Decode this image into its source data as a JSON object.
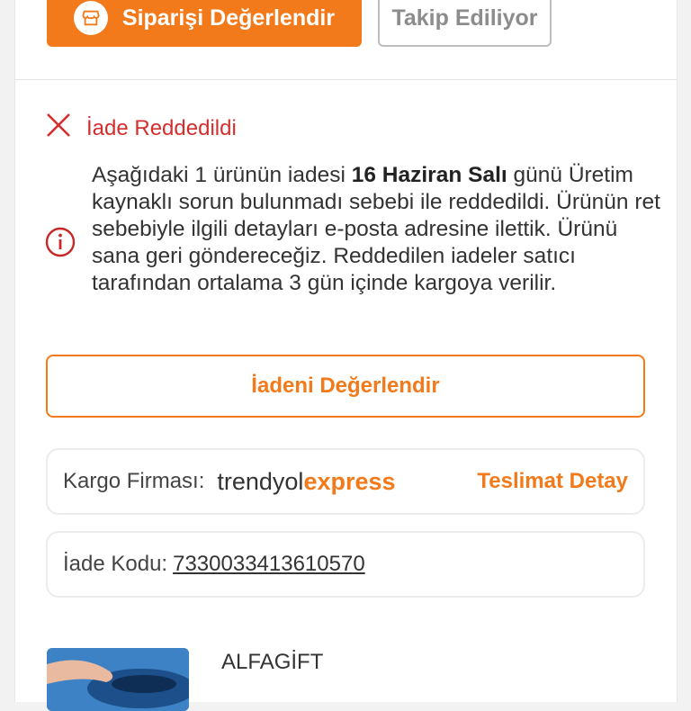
{
  "top_buttons": {
    "rate_order": "Siparişi Değerlendir",
    "following": "Takip Ediliyor"
  },
  "status": {
    "title": "İade Reddedildi",
    "color": "#d32f2f"
  },
  "notice": {
    "line_1_prefix": "Aşağıdaki 1 ürünün iadesi ",
    "date": "16 Haziran Salı",
    "line_1_suffix": " günü",
    "rest": "Üretim kaynaklı sorun bulunmadı sebebi ile reddedildi. Ürünün ret sebebiyle ilgili detayları e-posta adresine ilettik. Ürünü sana geri göndereceğiz. Reddedilen iadeler satıcı tarafından ortalama 3 gün içinde kargoya verilir."
  },
  "rate_return_button": "İadeni Değerlendir",
  "cargo": {
    "label": "Kargo Firması:",
    "brand_part1": "trendyol",
    "brand_part2": "express",
    "detail_link": "Teslimat Detay"
  },
  "return_code": {
    "label": "İade Kodu:",
    "value": "7330033413610570"
  },
  "product": {
    "brand": "ALFAGİFT"
  },
  "colors": {
    "accent": "#f27a1a",
    "error": "#d32f2f"
  }
}
